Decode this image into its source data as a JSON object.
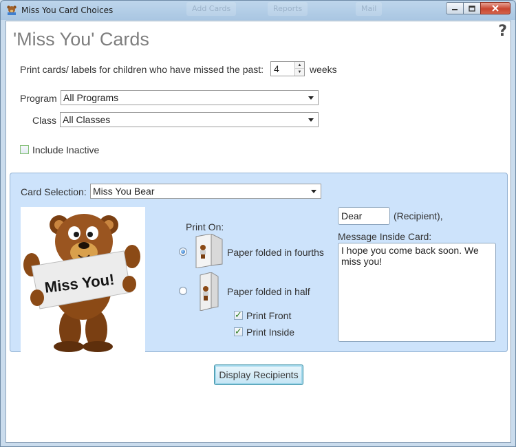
{
  "window": {
    "title": "Miss You Card Choices",
    "background_tabs": [
      "Add Cards",
      "Reports",
      "Mail"
    ]
  },
  "page": {
    "heading": "'Miss You' Cards",
    "help_glyph": "?"
  },
  "weeks_filter": {
    "label": "Print cards/ labels for children who have missed the past:",
    "value": "4",
    "unit": "weeks"
  },
  "program": {
    "label": "Program",
    "value": "All Programs"
  },
  "class_filter": {
    "label": "Class",
    "value": "All Classes"
  },
  "include_inactive": {
    "label": "Include Inactive",
    "checked": false
  },
  "card_selection": {
    "label": "Card Selection:",
    "value": "Miss You Bear",
    "image_text": "Miss You!"
  },
  "print_on": {
    "label": "Print On:",
    "options": [
      {
        "label": "Paper folded in fourths",
        "selected": true
      },
      {
        "label": "Paper folded in half",
        "selected": false
      }
    ],
    "print_front": {
      "label": "Print Front",
      "checked": true
    },
    "print_inside": {
      "label": "Print Inside",
      "checked": true
    }
  },
  "greeting": {
    "salutation": "Dear",
    "suffix": "(Recipient),"
  },
  "message": {
    "label": "Message Inside Card:",
    "text": "I hope you come back soon.  We miss you!"
  },
  "actions": {
    "display_recipients": "Display Recipients"
  },
  "colors": {
    "panel": "#cde3fb",
    "heading": "#7e7e7e",
    "button_border": "#3a8ea3"
  }
}
